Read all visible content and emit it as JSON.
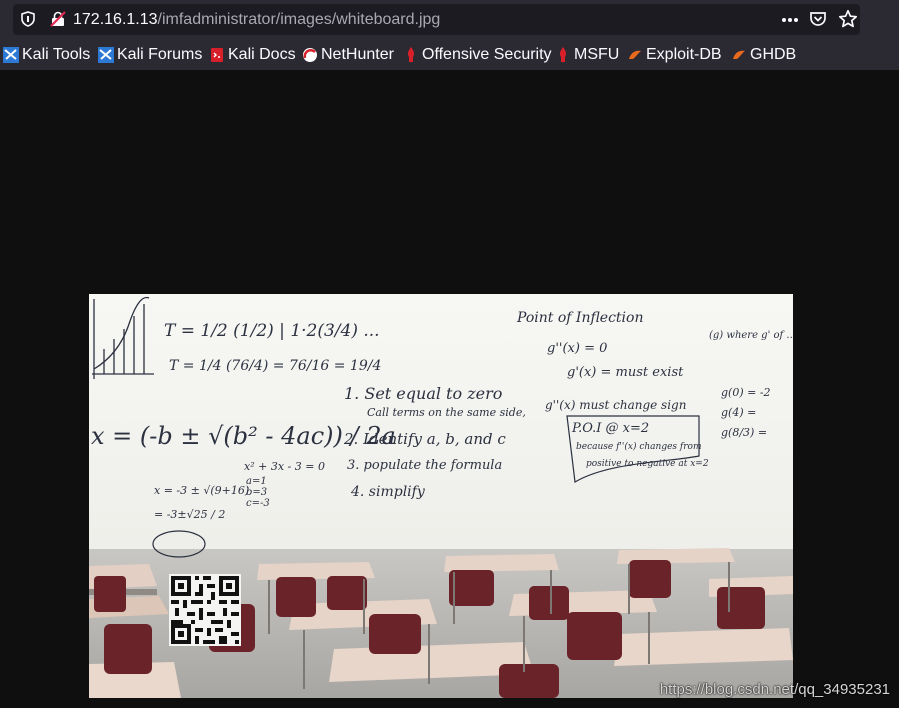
{
  "browser": {
    "url_host": "172.16.1.13",
    "url_path": "/imfadministrator/images/whiteboard.jpg"
  },
  "bookmarks": [
    {
      "label": "Kali Tools",
      "icon": "kali-dragon-icon"
    },
    {
      "label": "Kali Forums",
      "icon": "kali-dragon-icon"
    },
    {
      "label": "Kali Docs",
      "icon": "kali-docs-icon"
    },
    {
      "label": "NetHunter",
      "icon": "nethunter-icon"
    },
    {
      "label": "Offensive Security",
      "icon": "offsec-icon"
    },
    {
      "label": "MSFU",
      "icon": "offsec-icon"
    },
    {
      "label": "Exploit-DB",
      "icon": "exploitdb-icon"
    },
    {
      "label": "GHDB",
      "icon": "exploitdb-icon"
    }
  ],
  "whiteboard": {
    "steps": [
      "1. Set equal to zero",
      "Call terms on the same side,",
      "2. Identify a, b, and c",
      "3. populate the formula",
      "4. simplify"
    ],
    "inflection_title": "Point of Inflection",
    "inflection_lines": [
      "g''(x) = 0",
      "g'(x) = must exist",
      "g''(x) must change sign",
      "P.O.I @ x=2",
      "because f''(x) changes from",
      "positive to negative at x=2"
    ],
    "right_lines": [
      "(g) where g' of ...",
      "g(0) = -2",
      "g(4) =",
      "g(8/3) ="
    ],
    "quadratic": "x = (-b ± √(b² - 4ac)) / 2a",
    "left_lines": [
      "T = 1/2 (1/2) | 1·2(3/4) ...",
      "T = 1/4 (76/4) = 76/16 = 19/4",
      "x = -3 ± √(9+16)",
      "= -3±√25 / 2"
    ],
    "example_lines": [
      "x² + 3x - 3 = 0",
      "a=1",
      "b=3",
      "c=-3"
    ]
  },
  "watermark": "https://blog.csdn.net/qq_34935231",
  "colors": {
    "toolbar": "#2b2a33",
    "urlbar": "#1c1b22",
    "viewer_bg": "#0f0f0f"
  }
}
